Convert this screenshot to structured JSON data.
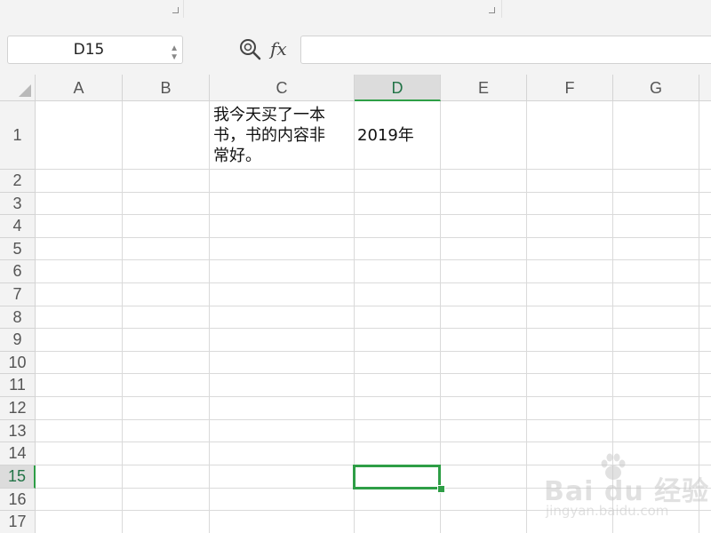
{
  "name_box": {
    "value": "D15"
  },
  "formula_bar": {
    "fx_label": "fx",
    "value": ""
  },
  "columns": [
    "A",
    "B",
    "C",
    "D",
    "E",
    "F",
    "G"
  ],
  "active_column": "D",
  "rows": [
    "1",
    "2",
    "3",
    "4",
    "5",
    "6",
    "7",
    "8",
    "9",
    "10",
    "11",
    "12",
    "13",
    "14",
    "15",
    "16",
    "17"
  ],
  "active_row": "15",
  "cells": {
    "C1": "我今天买了一本\n书，书的内容非\n常好。",
    "D1": "2019年"
  },
  "selected_cell": "D15",
  "watermark": {
    "logo": "Bai du 经验",
    "url": "jingyan.baidu.com"
  },
  "colors": {
    "accent": "#2e9e46",
    "header_bg": "#f3f3f3",
    "gridline": "#dadada"
  },
  "icons": {
    "zoom": "zoom-magnifier-icon",
    "fx": "fx-icon",
    "dropdown": "chevron-down-icon"
  }
}
